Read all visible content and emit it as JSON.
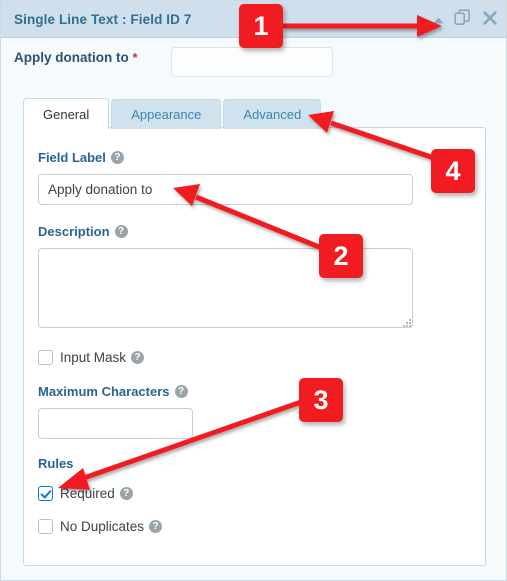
{
  "window": {
    "title": "Single Line Text : Field ID 7",
    "actions": [
      {
        "name": "collapse-icon",
        "glyph": "▲",
        "label": "Collapse"
      },
      {
        "name": "duplicate-icon",
        "glyph": "",
        "label": "Duplicate"
      },
      {
        "name": "close-icon",
        "glyph": "✖",
        "label": "Close"
      }
    ]
  },
  "summary": {
    "label": "Apply donation to",
    "required_marker": "*",
    "input_value": "",
    "input_placeholder": ""
  },
  "tabs": [
    {
      "label": "General",
      "active": true
    },
    {
      "label": "Appearance",
      "active": false
    },
    {
      "label": "Advanced",
      "active": false
    }
  ],
  "general": {
    "field_label": {
      "label": "Field Label",
      "help": "?",
      "value": "Apply donation to",
      "placeholder": ""
    },
    "description": {
      "label": "Description",
      "help": "?",
      "value": "",
      "placeholder": ""
    },
    "input_mask": {
      "label": "Input Mask",
      "help": "?",
      "checked": false
    },
    "maximum_characters": {
      "label": "Maximum Characters",
      "help": "?",
      "value": "",
      "placeholder": ""
    },
    "rules": {
      "heading": "Rules",
      "required": {
        "label": "Required",
        "help": "?",
        "checked": true
      },
      "no_duplicates": {
        "label": "No Duplicates",
        "help": "?",
        "checked": false
      }
    }
  },
  "annotations": [
    {
      "number": "1",
      "target": "titlebar-actions"
    },
    {
      "number": "2",
      "target": "field-label-input"
    },
    {
      "number": "3",
      "target": "required-checkbox"
    },
    {
      "number": "4",
      "target": "advanced-tab"
    }
  ],
  "colors": {
    "titlebar_bg": "#cfdfeb",
    "titlebar_text": "#31708f",
    "tab_inactive_bg": "#cfe2ee",
    "tab_active_bg": "#ffffff",
    "label_blue": "#2a6496",
    "accent_red": "#f01c22",
    "checkbox_checked": "#0c7cbf",
    "required_star": "#cc3333",
    "panel_border": "#c6dae6",
    "page_bg": "#f5fafd"
  }
}
